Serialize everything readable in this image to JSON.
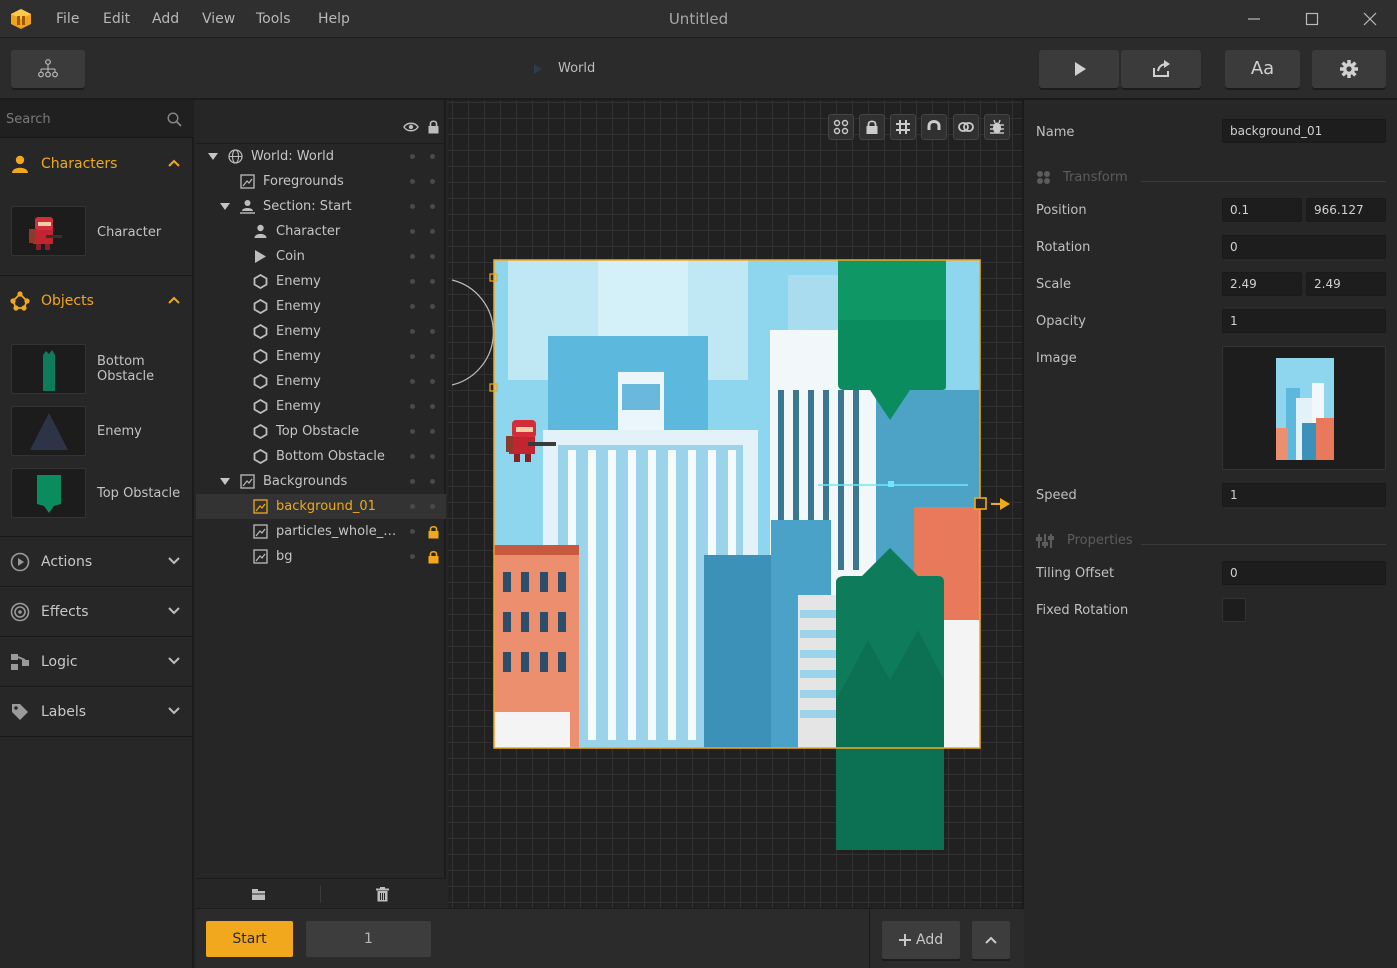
{
  "app": {
    "title": "Untitled",
    "menu": [
      "File",
      "Edit",
      "Add",
      "View",
      "Tools",
      "Help"
    ]
  },
  "toolbar": {
    "breadcrumb": "World",
    "font_button": "Aa"
  },
  "left": {
    "search_placeholder": "Search",
    "characters_label": "Characters",
    "character_item": "Character",
    "objects_label": "Objects",
    "objects": [
      {
        "label1": "Bottom",
        "label2": "Obstacle"
      },
      {
        "label1": "Enemy"
      },
      {
        "label1": "Top Obstacle"
      }
    ],
    "collapsed": [
      "Actions",
      "Effects",
      "Logic",
      "Labels"
    ]
  },
  "hierarchy": {
    "rows": [
      {
        "text": "World: World",
        "icon": "globe-icon"
      },
      {
        "text": "Foregrounds",
        "icon": "image-icon"
      },
      {
        "text": "Section: Start",
        "icon": "section-icon"
      },
      {
        "text": "Character",
        "icon": "person-icon"
      },
      {
        "text": "Coin",
        "icon": "play-icon"
      },
      {
        "text": "Enemy",
        "icon": "hexagon-icon"
      },
      {
        "text": "Enemy",
        "icon": "hexagon-icon"
      },
      {
        "text": "Enemy",
        "icon": "hexagon-icon"
      },
      {
        "text": "Enemy",
        "icon": "hexagon-icon"
      },
      {
        "text": "Enemy",
        "icon": "hexagon-icon"
      },
      {
        "text": "Enemy",
        "icon": "hexagon-icon"
      },
      {
        "text": "Top Obstacle",
        "icon": "hexagon-icon"
      },
      {
        "text": "Bottom Obstacle",
        "icon": "hexagon-icon"
      },
      {
        "text": "Backgrounds",
        "icon": "image-icon"
      },
      {
        "text": "background_01",
        "icon": "image-icon"
      },
      {
        "text": "particles_whole_…",
        "icon": "image-icon"
      },
      {
        "text": "bg",
        "icon": "image-icon"
      }
    ]
  },
  "inspector": {
    "name_label": "Name",
    "name_value": "background_01",
    "transform_label": "Transform",
    "position_label": "Position",
    "position_x": "0.1",
    "position_y": "966.127",
    "rotation_label": "Rotation",
    "rotation_value": "0",
    "scale_label": "Scale",
    "scale_x": "2.49",
    "scale_y": "2.49",
    "opacity_label": "Opacity",
    "opacity_value": "1",
    "image_label": "Image",
    "speed_label": "Speed",
    "speed_value": "1",
    "properties_label": "Properties",
    "tiling_label": "Tiling Offset",
    "tiling_value": "0",
    "fixed_rotation_label": "Fixed Rotation"
  },
  "bottom": {
    "start_label": "Start",
    "section_number": "1",
    "add_label": "Add"
  },
  "colors": {
    "accent": "#f2a81d",
    "sky": "#8ed6ee",
    "obstacle": "#0e7c5a"
  }
}
